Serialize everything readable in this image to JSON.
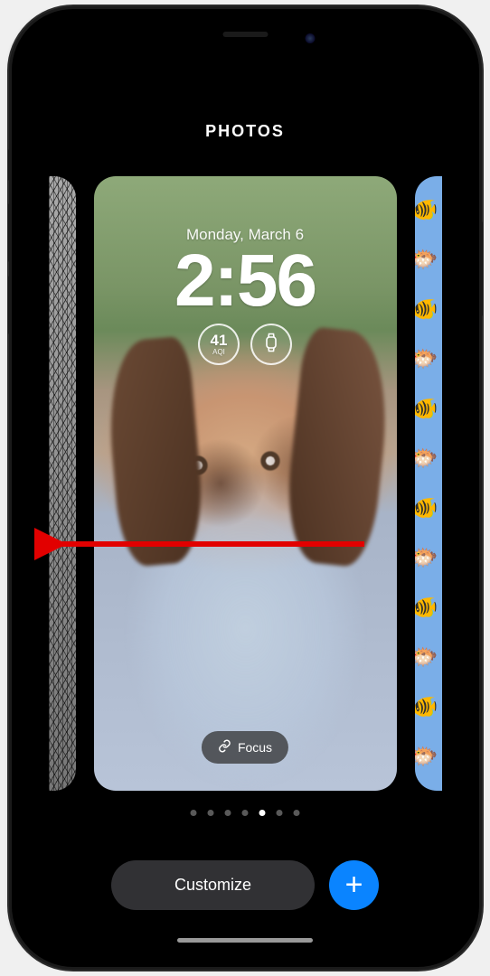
{
  "header": {
    "category_title": "PHOTOS"
  },
  "lockscreen": {
    "date": "Monday, March 6",
    "time": "2:56",
    "widgets": {
      "aqi": {
        "value": "41",
        "label": "AQI"
      },
      "watch": {
        "icon": "watch"
      }
    },
    "focus_label": "Focus"
  },
  "pager": {
    "count": 7,
    "active_index": 4
  },
  "controls": {
    "customize": "Customize",
    "add_label": "+"
  },
  "fish_pattern": [
    "🐠",
    "🐡",
    "🐠",
    "🐡",
    "🐠",
    "🐡",
    "🐠",
    "🐡",
    "🐠",
    "🐡",
    "🐠",
    "🐡"
  ]
}
